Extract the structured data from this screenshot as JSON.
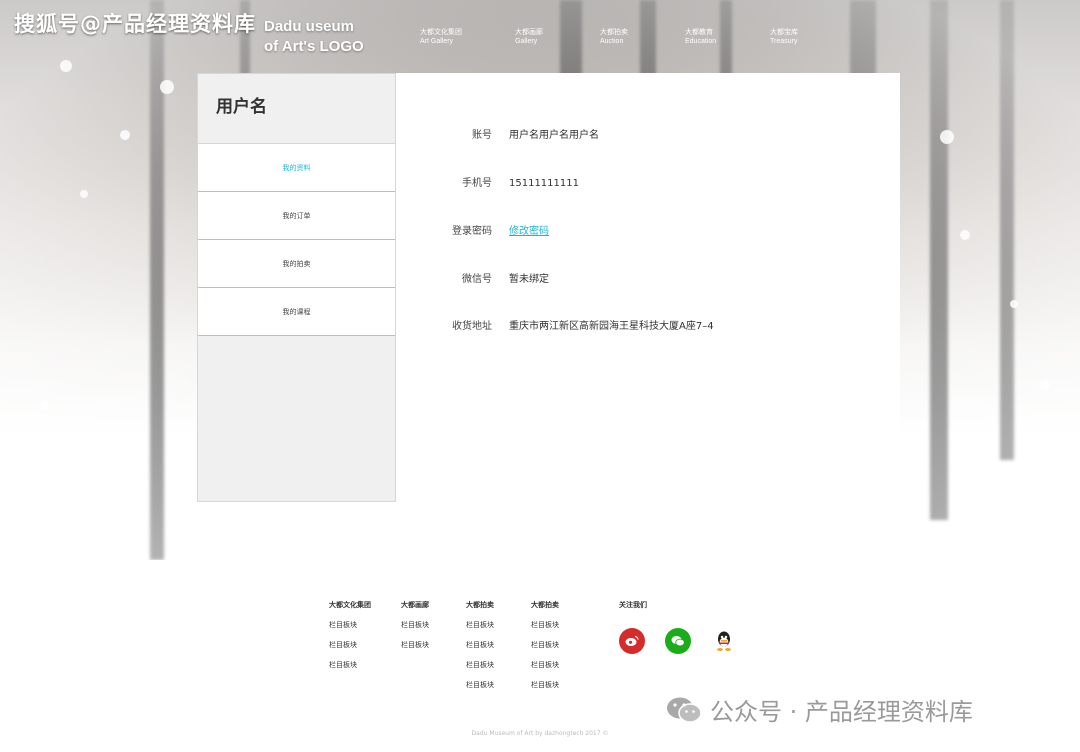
{
  "watermark": {
    "top": "搜狐号@产品经理资料库",
    "bottom": "公众号 · 产品经理资料库"
  },
  "logo": {
    "line1": "Dadu useum",
    "line2": "of Art's LOGO"
  },
  "nav": [
    {
      "zh": "大都文化集团",
      "en": "Art  Gallery"
    },
    {
      "zh": "大都画廊",
      "en": "Gallery"
    },
    {
      "zh": "大都拍卖",
      "en": "Auction"
    },
    {
      "zh": "大都教育",
      "en": "Education"
    },
    {
      "zh": "大都宝库",
      "en": "Treasury"
    }
  ],
  "sidebar": {
    "title": "用户名",
    "items": [
      {
        "label": "我的资料",
        "active": true
      },
      {
        "label": "我的订单",
        "active": false
      },
      {
        "label": "我的拍卖",
        "active": false
      },
      {
        "label": "我的课程",
        "active": false
      }
    ]
  },
  "profile": [
    {
      "key": "账号",
      "value": "用户名用户名用户名"
    },
    {
      "key": "手机号",
      "value": "15111111111"
    },
    {
      "key": "登录密码",
      "value": "修改密码"
    },
    {
      "key": "微信号",
      "value": "暂未绑定"
    },
    {
      "key": "收货地址",
      "value": "重庆市两江新区高新园海王星科技大厦A座7–4"
    }
  ],
  "footer": {
    "columns": [
      {
        "title": "大都文化集团",
        "items": [
          "栏目板块",
          "栏目板块",
          "栏目板块"
        ]
      },
      {
        "title": "大都画廊",
        "items": [
          "栏目板块",
          "栏目板块"
        ]
      },
      {
        "title": "大都拍卖",
        "items": [
          "栏目板块",
          "栏目板块",
          "栏目板块",
          "栏目板块"
        ]
      },
      {
        "title": "大都拍卖",
        "items": [
          "栏目板块",
          "栏目板块",
          "栏目板块",
          "栏目板块"
        ]
      }
    ],
    "follow_title": "关注我们",
    "social": [
      {
        "icon": "weibo-icon",
        "color": "#d52b2b"
      },
      {
        "icon": "wechat-icon",
        "color": "#1aad19"
      },
      {
        "icon": "qq-icon",
        "color": "#ffffff"
      }
    ],
    "copyright": "Dadu Museum of Art by dazhongtech 2017 ©"
  },
  "colors": {
    "accent": "#1eb4d8"
  }
}
